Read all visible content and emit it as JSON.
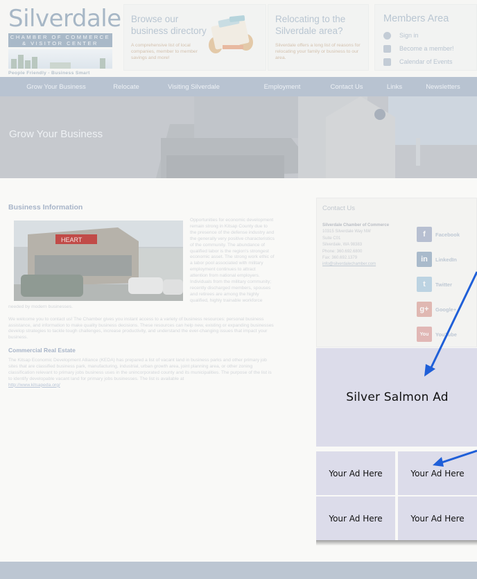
{
  "logo": {
    "name": "Silverdale",
    "subtitle": "CHAMBER OF COMMERCE & VISITOR CENTER",
    "tagline": "People Friendly - Business Smart"
  },
  "promos": [
    {
      "title": "Browse our business directory",
      "text": "A comprehensive list of local companies, member to member savings and more!"
    },
    {
      "title": "Relocating to the Silverdale area?",
      "text": "Silverdale offers a long list of reasons for relocating your family or business to our area."
    }
  ],
  "members": {
    "title": "Members Area",
    "items": [
      {
        "label": "Sign in",
        "icon": "user-icon"
      },
      {
        "label": "Become a member!",
        "icon": "arrow-right-icon"
      },
      {
        "label": "Calendar of Events",
        "icon": "calendar-icon"
      }
    ]
  },
  "nav": [
    "Grow Your Business",
    "Relocate",
    "Visiting Silverdale",
    "Employment",
    "Contact Us",
    "Links",
    "Newsletters"
  ],
  "hero": {
    "title": "Grow Your Business"
  },
  "main": {
    "heading": "Business Information",
    "para1_lead": "Opportunities for economic development remain strong in Kitsap County due to the presence of the defense industry and the generally very positive characteristics of the community. The abundance of qualified labor is the region's strongest economic asset. The strong work ethic of a labor pool associated with military employment continues to attract attention from national employers. Individuals from the military community; recently discharged members, spouses and retirees are among the highly qualified, highly trainable workforce needed by modern businesses.",
    "para2": "We welcome you to contact us! The Chamber gives you instant access to a variety of business resources: personal business assistance, and information to make quality business decisions. These resources can help new, existing or expanding businesses develop strategies to tackle tough challenges, increase productivity, and understand the ever-changing issues that impact your business.",
    "subheading": "Commercial Real Estate",
    "para3": "The Kitsap Economic Development Alliance (KEDA) has prepared a list of vacant land in business parks and other primary job sites that are classified business park, manufacturing, industrial, urban growth area, joint planning area, or other zoning classification relevant to primary jobs business uses in the unincorporated county and its municipalities. The purpose of the list is to identify developable vacant land for primary jobs businesses. The list is available at",
    "link": "http://www.kitsapeda.org/",
    "photo_sign": "HEART"
  },
  "contact": {
    "title": "Contact Us",
    "org": "Silverdale Chamber of Commerce",
    "address_lines": [
      "10315 Silverdale Way NW",
      "Suite C01",
      "Silverdale, WA 98383",
      "Phone: 360.692.6800",
      "Fax: 360.692.1379"
    ],
    "email": "info@silverdalechamber.com",
    "social": [
      {
        "label": "Facebook",
        "icon": "facebook-icon",
        "glyph": "f",
        "color": "#b7bfd1"
      },
      {
        "label": "LinkedIn",
        "icon": "linkedin-icon",
        "glyph": "in",
        "color": "#a9bacb"
      },
      {
        "label": "Twitter",
        "icon": "twitter-icon",
        "glyph": "t",
        "color": "#bcd3e2"
      },
      {
        "label": "Google+",
        "icon": "google-plus-icon",
        "glyph": "g+",
        "color": "#e0b8b2"
      },
      {
        "label": "YouTube",
        "icon": "youtube-icon",
        "glyph": "You",
        "color": "#e1b7b5"
      }
    ]
  },
  "ads": {
    "big": "Silver Salmon Ad",
    "cells": [
      "Your Ad Here",
      "Your Ad Here",
      "Your Ad Here",
      "Your Ad Here"
    ]
  },
  "colors": {
    "nav": "#b8c3d1",
    "ad": "#dcdcea",
    "arrow": "#1f5fd8"
  }
}
